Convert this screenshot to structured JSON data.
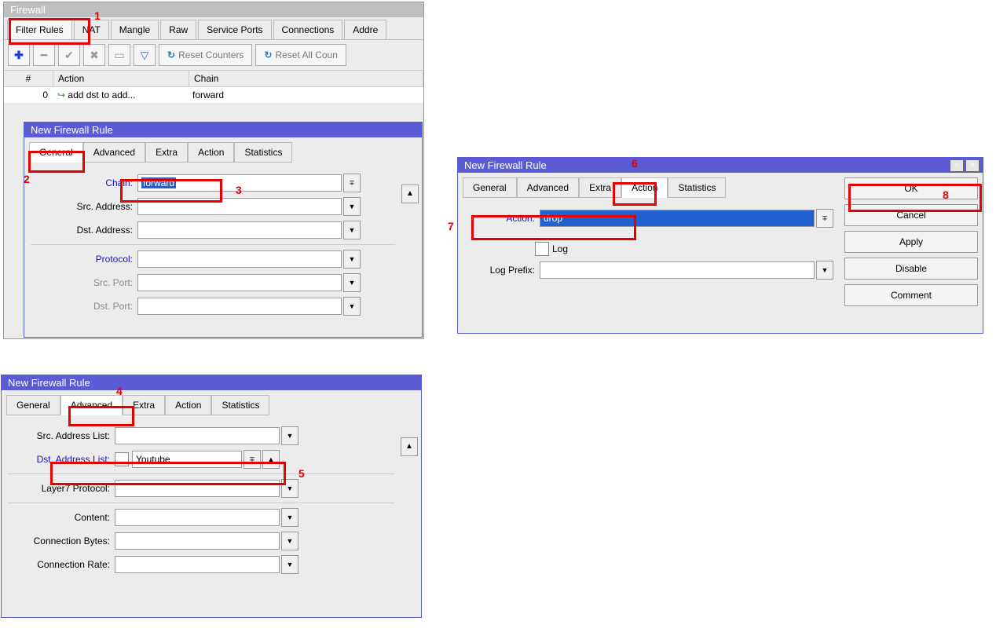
{
  "firewall": {
    "title": "Firewall",
    "tabs": [
      "Filter Rules",
      "NAT",
      "Mangle",
      "Raw",
      "Service Ports",
      "Connections",
      "Addre"
    ],
    "toolbar": {
      "reset_counters": "Reset Counters",
      "reset_all": "Reset All Coun"
    },
    "columns": {
      "num": "#",
      "action": "Action",
      "chain": "Chain"
    },
    "rows": [
      {
        "num": "0",
        "icon": "↪",
        "action": "add dst to add...",
        "chain": "forward"
      }
    ]
  },
  "rule1": {
    "title": "New Firewall Rule",
    "subtabs": [
      "General",
      "Advanced",
      "Extra",
      "Action",
      "Statistics"
    ],
    "labels": {
      "chain": "Chain:",
      "src_addr": "Src. Address:",
      "dst_addr": "Dst. Address:",
      "protocol": "Protocol:",
      "src_port": "Src. Port:",
      "dst_port": "Dst. Port:"
    },
    "values": {
      "chain": "forward"
    }
  },
  "rule2": {
    "title": "New Firewall Rule",
    "subtabs": [
      "General",
      "Advanced",
      "Extra",
      "Action",
      "Statistics"
    ],
    "labels": {
      "src_addr_list": "Src. Address List:",
      "dst_addr_list": "Dst. Address List:",
      "layer7": "Layer7 Protocol:",
      "content": "Content:",
      "conn_bytes": "Connection Bytes:",
      "conn_rate": "Connection Rate:"
    },
    "values": {
      "dst_addr_list": "Youtube"
    }
  },
  "rule3": {
    "title": "New Firewall Rule",
    "subtabs": [
      "General",
      "Advanced",
      "Extra",
      "Action",
      "Statistics"
    ],
    "labels": {
      "action": "Action:",
      "log": "Log",
      "log_prefix": "Log Prefix:"
    },
    "values": {
      "action": "drop"
    },
    "buttons": {
      "ok": "OK",
      "cancel": "Cancel",
      "apply": "Apply",
      "disable": "Disable",
      "comment": "Comment"
    }
  },
  "anno": {
    "1": "1",
    "2": "2",
    "3": "3",
    "4": "4",
    "5": "5",
    "6": "6",
    "7": "7",
    "8": "8"
  }
}
